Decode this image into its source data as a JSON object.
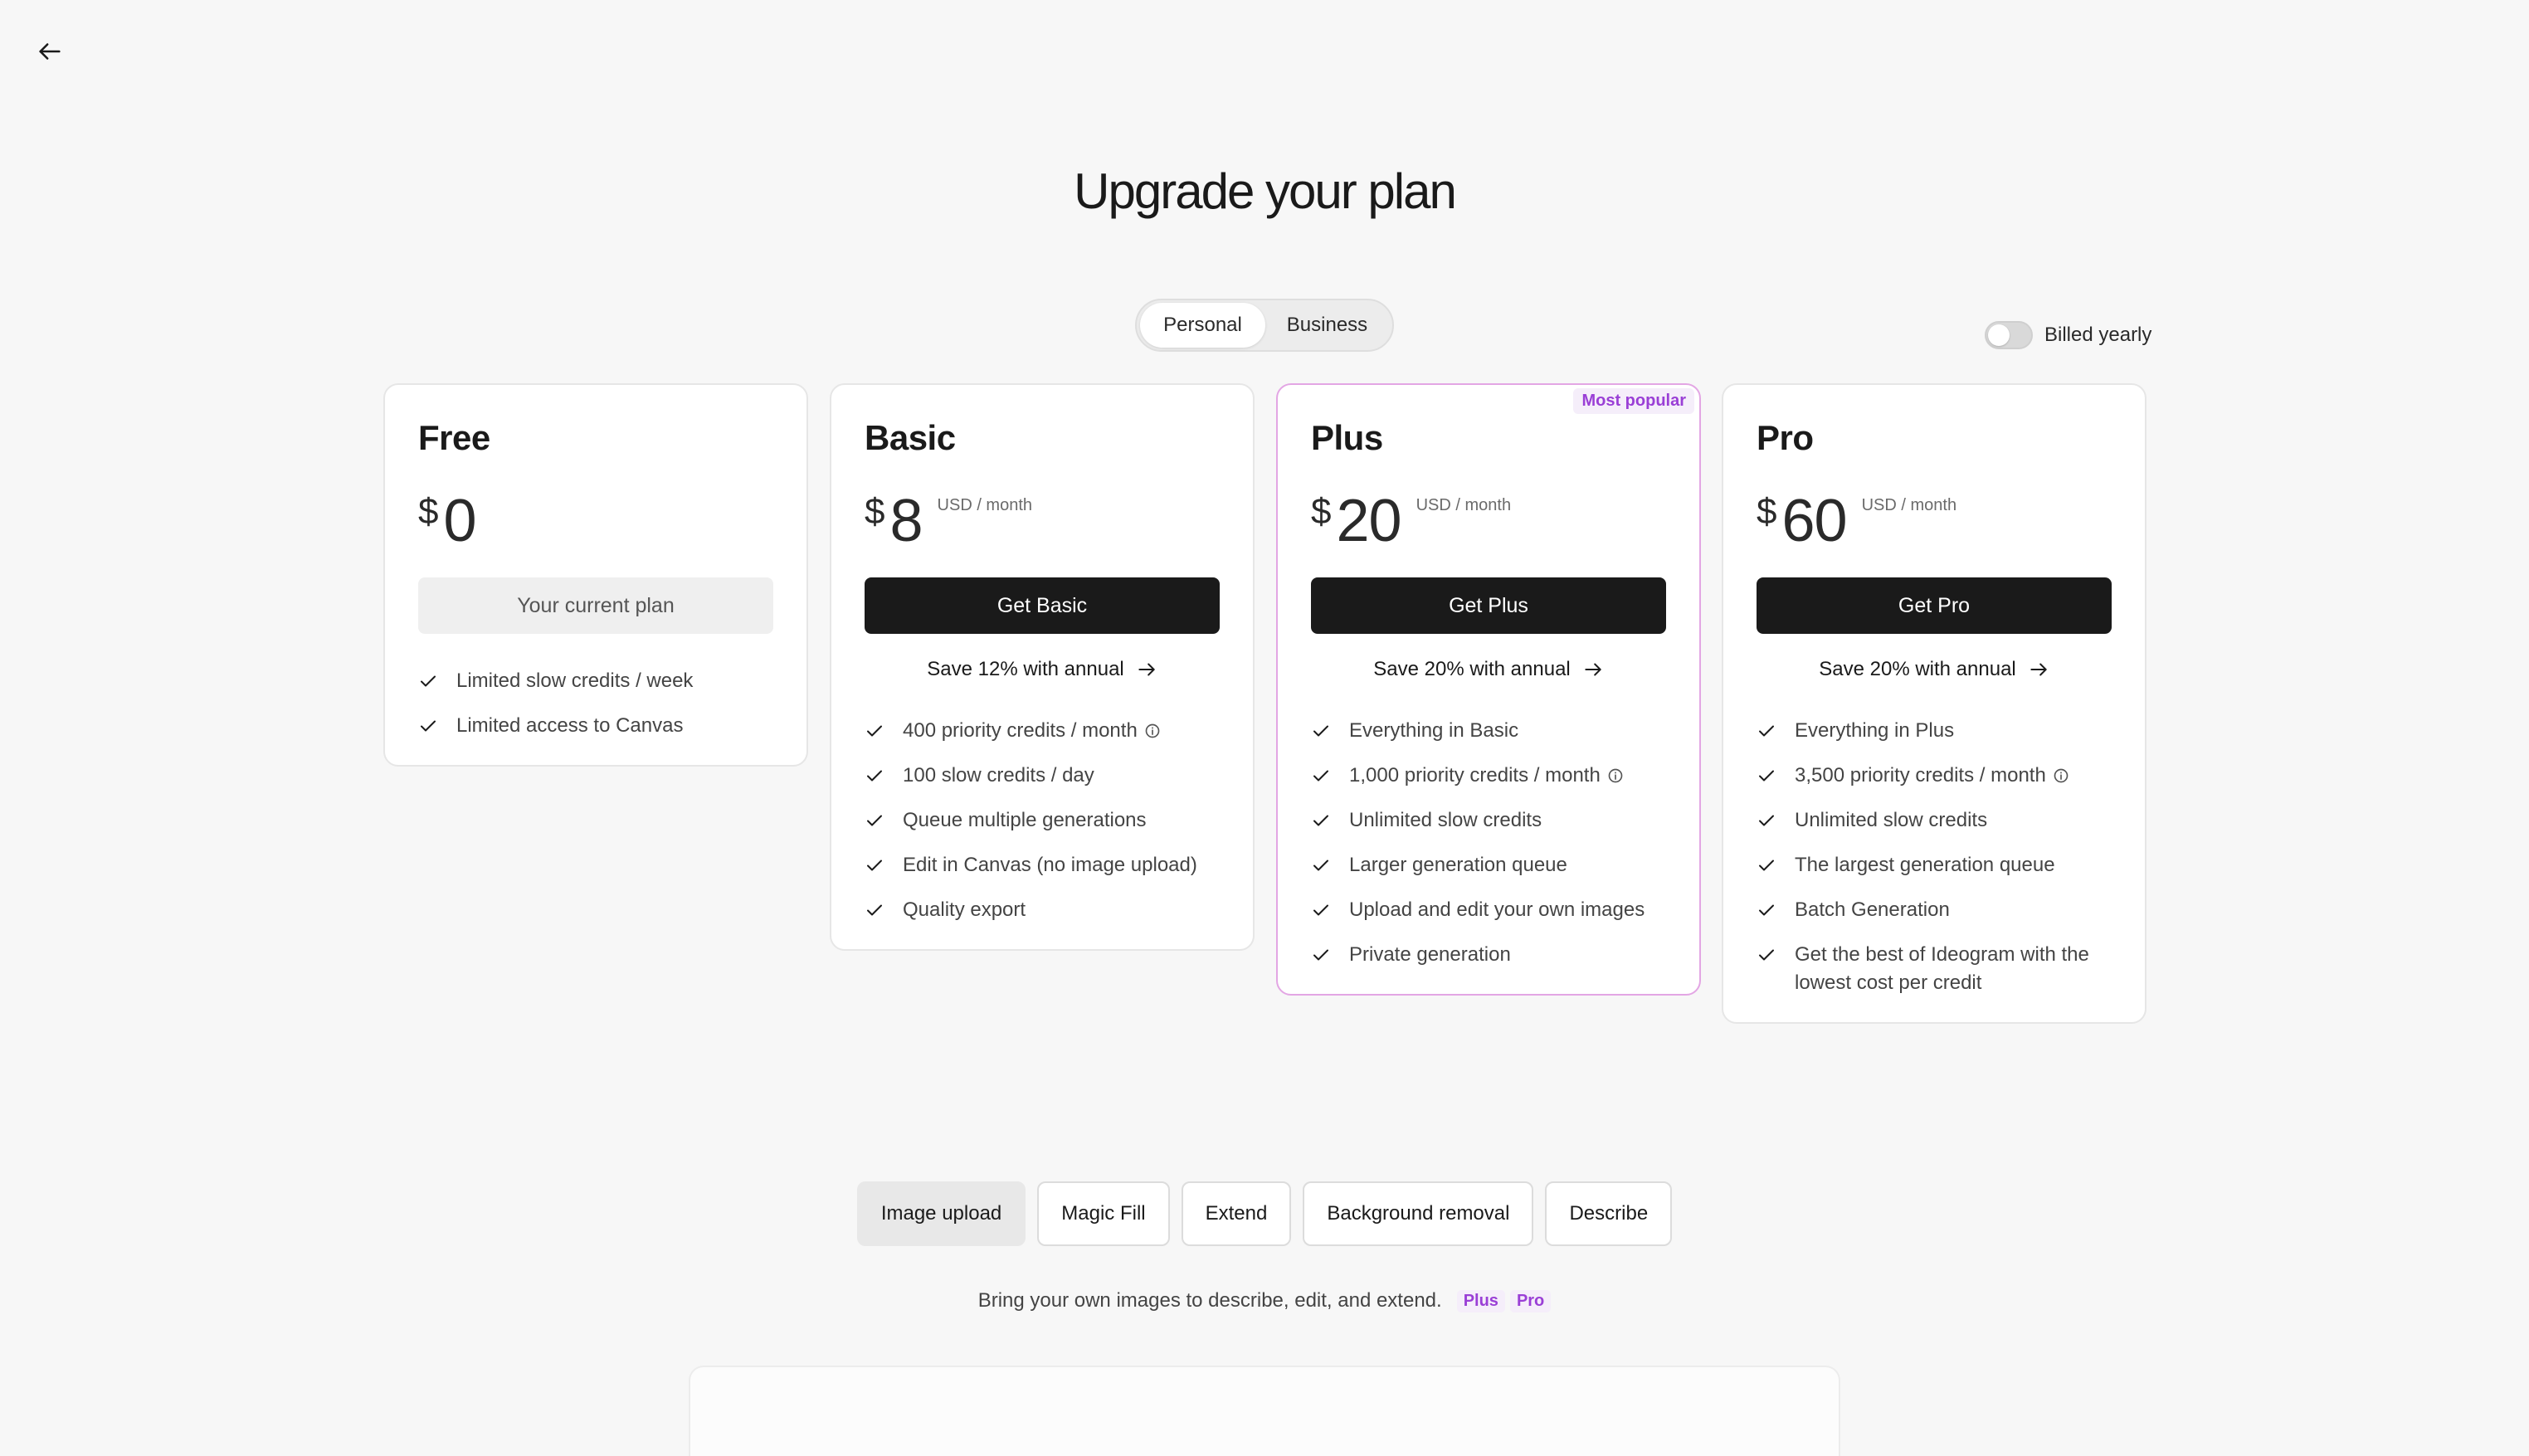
{
  "page": {
    "title": "Upgrade your plan"
  },
  "segment": {
    "personal": "Personal",
    "business": "Business",
    "active": "Personal"
  },
  "billing": {
    "label": "Billed yearly",
    "enabled": false
  },
  "plans": [
    {
      "name": "Free",
      "currency": "$",
      "amount": "0",
      "period": "",
      "cta": "Your current plan",
      "save": "",
      "features": [
        "Limited slow credits / week",
        "Limited access to Canvas"
      ]
    },
    {
      "name": "Basic",
      "currency": "$",
      "amount": "8",
      "period": "USD / month",
      "cta": "Get Basic",
      "save": "Save 12% with annual",
      "features": [
        "400 priority credits / month",
        "100 slow credits / day",
        "Queue multiple generations",
        "Edit in Canvas (no image upload)",
        "Quality export"
      ]
    },
    {
      "name": "Plus",
      "currency": "$",
      "amount": "20",
      "period": "USD / month",
      "cta": "Get Plus",
      "save": "Save 20% with annual",
      "badge": "Most popular",
      "features": [
        "Everything in Basic",
        "1,000 priority credits / month",
        "Unlimited slow credits",
        "Larger generation queue",
        "Upload and edit your own images",
        "Private generation"
      ]
    },
    {
      "name": "Pro",
      "currency": "$",
      "amount": "60",
      "period": "USD / month",
      "cta": "Get Pro",
      "save": "Save 20% with annual",
      "features": [
        "Everything in Plus",
        "3,500 priority credits / month",
        "Unlimited slow credits",
        "The largest generation queue",
        "Batch Generation",
        "Get the best of Ideogram with the lowest cost per credit"
      ]
    }
  ],
  "feature_tabs": [
    "Image upload",
    "Magic Fill",
    "Extend",
    "Background removal",
    "Describe"
  ],
  "feature_desc": {
    "text": "Bring your own images to describe, edit, and extend.",
    "tags": [
      "Plus",
      "Pro"
    ]
  },
  "colors": {
    "accent": "#9a3fd6",
    "dark": "#1a1a1a",
    "popular_border": "#e3a6e4"
  },
  "icons": {
    "back": "arrow-left-icon",
    "check": "check-icon",
    "info": "info-icon",
    "arrow": "arrow-right-icon"
  }
}
